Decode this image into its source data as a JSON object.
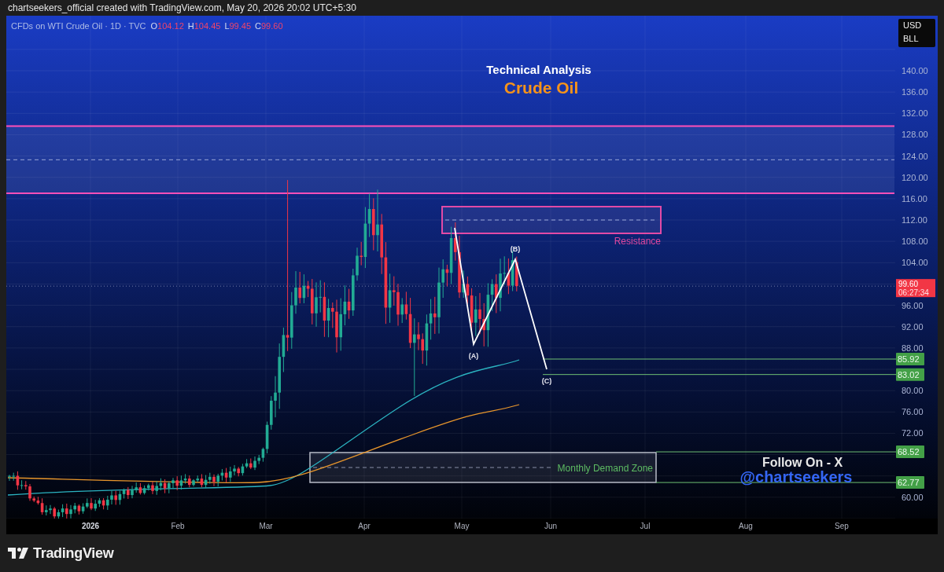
{
  "header": {
    "caption": "chartseekers_official created with TradingView.com, May 20, 2026 20:02 UTC+5:30"
  },
  "legend": {
    "symbol": "CFDs on WTI Crude Oil · 1D · TVC",
    "ohlc": [
      {
        "key": "O",
        "value": "104.12"
      },
      {
        "key": "H",
        "value": "104.45"
      },
      {
        "key": "L",
        "value": "99.45"
      },
      {
        "key": "C",
        "value": "99.60"
      }
    ]
  },
  "currency": [
    "USD",
    "BLL"
  ],
  "title": {
    "heading": "Technical Analysis",
    "subject": "Crude Oil"
  },
  "price_scale": [
    "140.00",
    "136.00",
    "132.00",
    "128.00",
    "124.00",
    "120.00",
    "116.00",
    "112.00",
    "108.00",
    "104.00",
    "96.00",
    "92.00",
    "88.00",
    "80.00",
    "76.00",
    "72.00",
    "60.00"
  ],
  "last_price": {
    "price": "99.60",
    "countdown": "06:27:34"
  },
  "levels": [
    {
      "price": "85.92"
    },
    {
      "price": "83.02"
    },
    {
      "price": "68.52"
    },
    {
      "price": "62.77"
    }
  ],
  "zones": {
    "resistance": "Resistance",
    "demand": "Monthly Demand Zone"
  },
  "wave_labels": [
    "(A)",
    "(B)",
    "(C)"
  ],
  "promo": {
    "line": "Follow On - X",
    "handle": "@chartseekers"
  },
  "time_axis": [
    "2026",
    "Feb",
    "Mar",
    "Apr",
    "May",
    "Jun",
    "Jul",
    "Aug",
    "Sep"
  ],
  "footer": {
    "brand": "TradingView"
  }
}
